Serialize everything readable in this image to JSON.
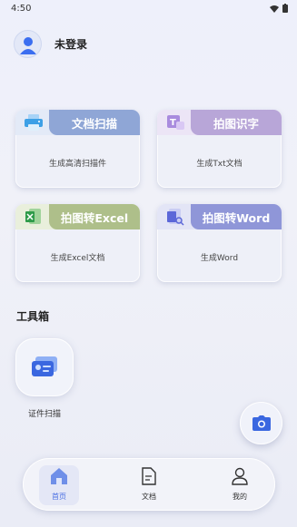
{
  "status": {
    "time": "4:50"
  },
  "user": {
    "name": "未登录"
  },
  "cards": [
    {
      "title": "文档扫描",
      "desc": "生成高清扫描件",
      "color": "#8fa6d6",
      "icon": "printer-icon"
    },
    {
      "title": "拍图识字",
      "desc": "生成Txt文档",
      "color": "#b8a6d8",
      "icon": "text-recognize-icon"
    },
    {
      "title": "拍图转Excel",
      "desc": "生成Excel文档",
      "color": "#aebf8a",
      "icon": "excel-icon"
    },
    {
      "title": "拍图转Word",
      "desc": "生成Word",
      "color": "#8f96d8",
      "icon": "word-icon"
    }
  ],
  "tools": {
    "section_title": "工具箱",
    "items": [
      {
        "label": "证件扫描",
        "icon": "id-card-icon"
      }
    ]
  },
  "tabs": [
    {
      "label": "首页",
      "icon": "home-icon",
      "active": true
    },
    {
      "label": "文档",
      "icon": "document-icon",
      "active": false
    },
    {
      "label": "我的",
      "icon": "profile-icon",
      "active": false
    }
  ],
  "colors": {
    "accent": "#4a6fe3"
  }
}
